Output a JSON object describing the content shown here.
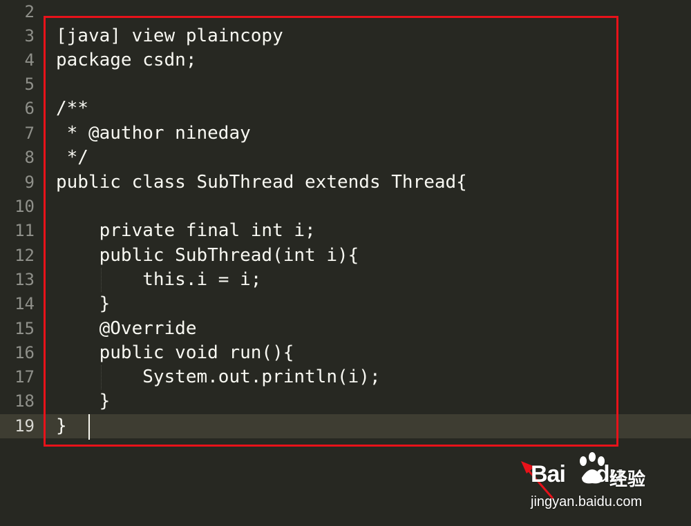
{
  "editor": {
    "theme": {
      "background": "#272822",
      "text": "#f8f8f2",
      "gutter_text": "#8f908a",
      "active_line": "#3e3d32",
      "highlight_border": "#e8121a"
    },
    "line_numbers": [
      "2",
      "3",
      "4",
      "5",
      "6",
      "7",
      "8",
      "9",
      "10",
      "11",
      "12",
      "13",
      "14",
      "15",
      "16",
      "17",
      "18",
      "19"
    ],
    "active_line_number": "19",
    "lines": [
      "",
      "[java] view plaincopy",
      "package csdn;",
      "",
      "/**",
      " * @author nineday",
      " */",
      "public class SubThread extends Thread{",
      "",
      "    private final int i;",
      "    public SubThread(int i){",
      "        this.i = i;",
      "    }",
      "    @Override",
      "    public void run(){",
      "        System.out.println(i);",
      "    }",
      "} "
    ]
  },
  "watermark": {
    "brand": "Bai",
    "brand_suffix": "du",
    "product": "经验",
    "url": "jingyan.baidu.com"
  }
}
